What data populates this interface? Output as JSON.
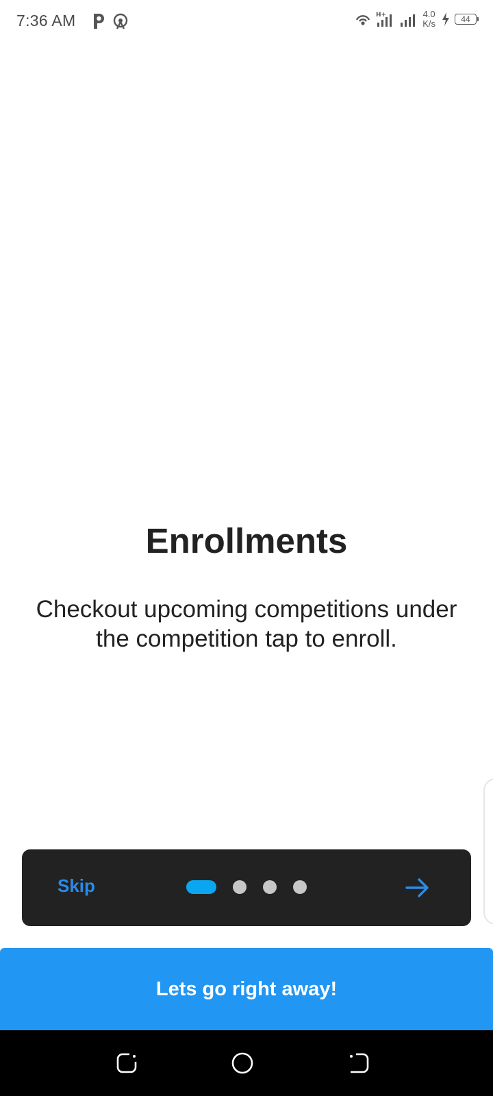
{
  "status_bar": {
    "time": "7:36 AM",
    "net_speed_value": "4.0",
    "net_speed_unit": "K/s",
    "battery_level": "44",
    "icons": [
      "parking-app-icon",
      "hotspot-icon",
      "wifi-icon",
      "signal-hplus-icon",
      "signal-icon",
      "charging-icon",
      "battery-icon"
    ]
  },
  "onboarding": {
    "title": "Enrollments",
    "description": "Checkout upcoming competitions under the competition tap to enroll.",
    "skip_label": "Skip",
    "page_count": 4,
    "active_page": 1
  },
  "cta": {
    "label": "Lets go right away!"
  },
  "colors": {
    "accent": "#2196f3",
    "skip_text": "#2a8be8",
    "active_dot": "#0aa7f0",
    "inactive_dot": "#c7c7c7",
    "nav_card_bg": "#222222"
  }
}
